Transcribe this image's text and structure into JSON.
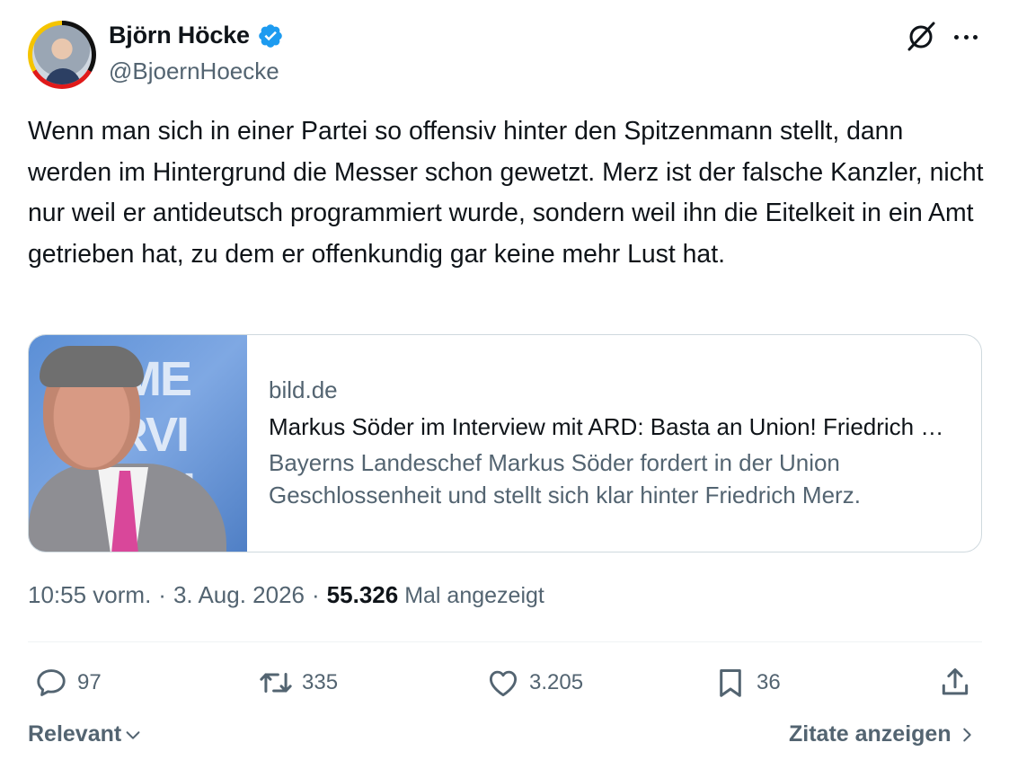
{
  "author": {
    "name": "Björn Höcke",
    "handle": "@BjoernHoecke",
    "verified": true
  },
  "header": {
    "grok_icon": "grok-icon",
    "more_icon": "more-horizontal-icon"
  },
  "tweet": {
    "text": "Wenn man sich in einer Partei so offensiv hinter den Spitzenmann stellt, dann werden im Hintergrund die Messer schon gewetzt. Merz ist der falsche Kanzler, nicht nur weil er antideutsch programmiert wurde, sondern weil ihn die Eitelkeit in ein Amt getrieben hat, zu dem er offenkundig gar keine mehr Lust hat."
  },
  "card": {
    "domain": "bild.de",
    "title": "Markus Söder im Interview mit ARD: Basta an Union! Friedrich Merz",
    "description": "Bayerns Landeschef Markus Söder fordert in der Union Geschlossenheit und stellt sich klar hinter Friedrich Merz.",
    "thumb_text": "MME\nTERVI\nRICH\nBE"
  },
  "meta": {
    "time": "10:55 vorm.",
    "separator": "·",
    "date": "3. Aug. 2026",
    "views_count": "55.326",
    "views_label": "Mal angezeigt"
  },
  "actions": {
    "replies": "97",
    "retweets": "335",
    "likes": "3.205",
    "bookmarks": "36"
  },
  "footer": {
    "sort_label": "Relevant",
    "quotes_label": "Zitate anzeigen"
  },
  "colors": {
    "text_primary": "#0f1419",
    "text_secondary": "#536471",
    "verified_blue": "#1d9bf0",
    "border": "#cfd9de"
  }
}
